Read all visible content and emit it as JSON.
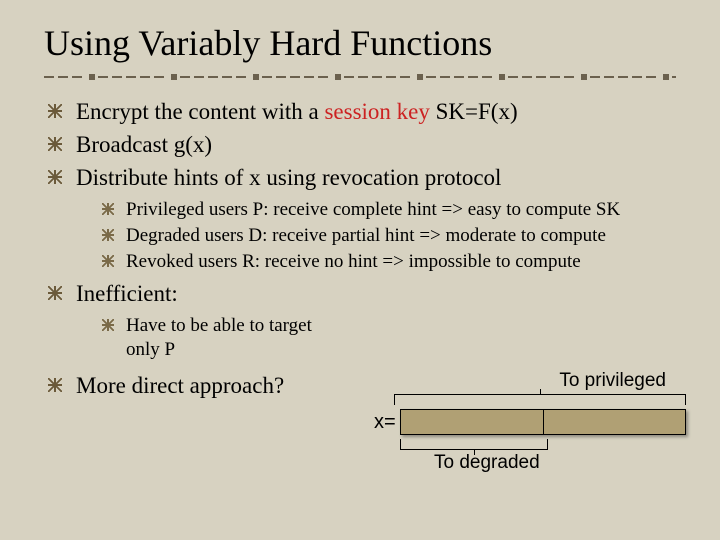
{
  "title": "Using Variably Hard Functions",
  "b1_pre": "Encrypt the content with a ",
  "b1_red": "session key",
  "b1_post": " SK=F(x)",
  "b2": "Broadcast g(x)",
  "b3": "Distribute hints of x using revocation protocol",
  "b3a": "Privileged users P: receive complete hint => easy to compute SK",
  "b3b": "Degraded users D: receive partial hint => moderate to compute",
  "b3c": "Revoked users R: receive no hint => impossible to compute",
  "b4": "Inefficient:",
  "b4a": "Have to be able to target only P",
  "b5": "More direct approach?",
  "diagram": {
    "top_label": "To privileged",
    "x_label": "x=",
    "bottom_label": "To degraded"
  }
}
